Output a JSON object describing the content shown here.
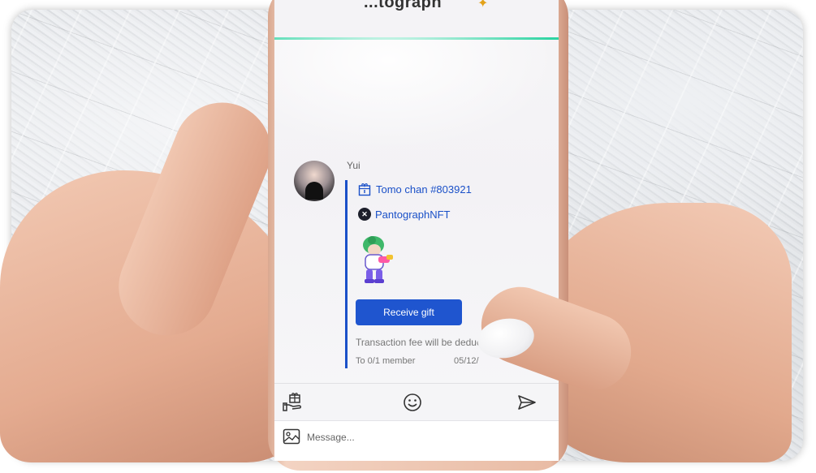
{
  "app": {
    "title_fragment": "...tograph"
  },
  "chat": {
    "sender_name": "Yui",
    "gift": {
      "item_name": "Tomo chan #803921",
      "collection_name": "PantographNFT",
      "receive_label": "Receive gift",
      "fee_note": "Transaction fee will be deduc",
      "recipient_text": "To 0/1 member",
      "date_text": "05/12/"
    }
  },
  "toolbar": {
    "icons": [
      "gift-hand-icon",
      "emoji-icon",
      "send-icon"
    ]
  },
  "composer": {
    "placeholder": "Message...",
    "value": ""
  },
  "colors": {
    "accent_blue": "#1f55cf",
    "header_line": "#2fd4a3"
  }
}
